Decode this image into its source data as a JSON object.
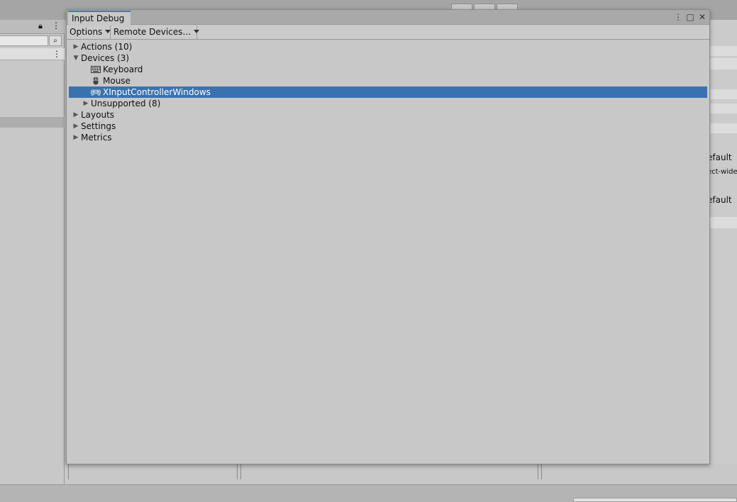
{
  "window": {
    "title": "Input Debug",
    "menu_icon": "⋮",
    "maximize_icon": "□",
    "close_icon": "✕"
  },
  "toolbar": {
    "options_label": "Options",
    "remote_label": "Remote Devices…"
  },
  "tree": {
    "actions": "Actions (10)",
    "devices": "Devices (3)",
    "keyboard": "Keyboard",
    "mouse": "Mouse",
    "xinput": "XInputControllerWindows",
    "unsupported": "Unsupported (8)",
    "layouts": "Layouts",
    "settings": "Settings",
    "metrics": "Metrics"
  },
  "background": {
    "right_label_1": "efault",
    "right_label_2": "ect-wide",
    "right_label_3": "efault"
  },
  "colors": {
    "selection": "#3a72b0",
    "accent_tab": "#3a79bb",
    "window_bg": "#c8c8c8"
  }
}
